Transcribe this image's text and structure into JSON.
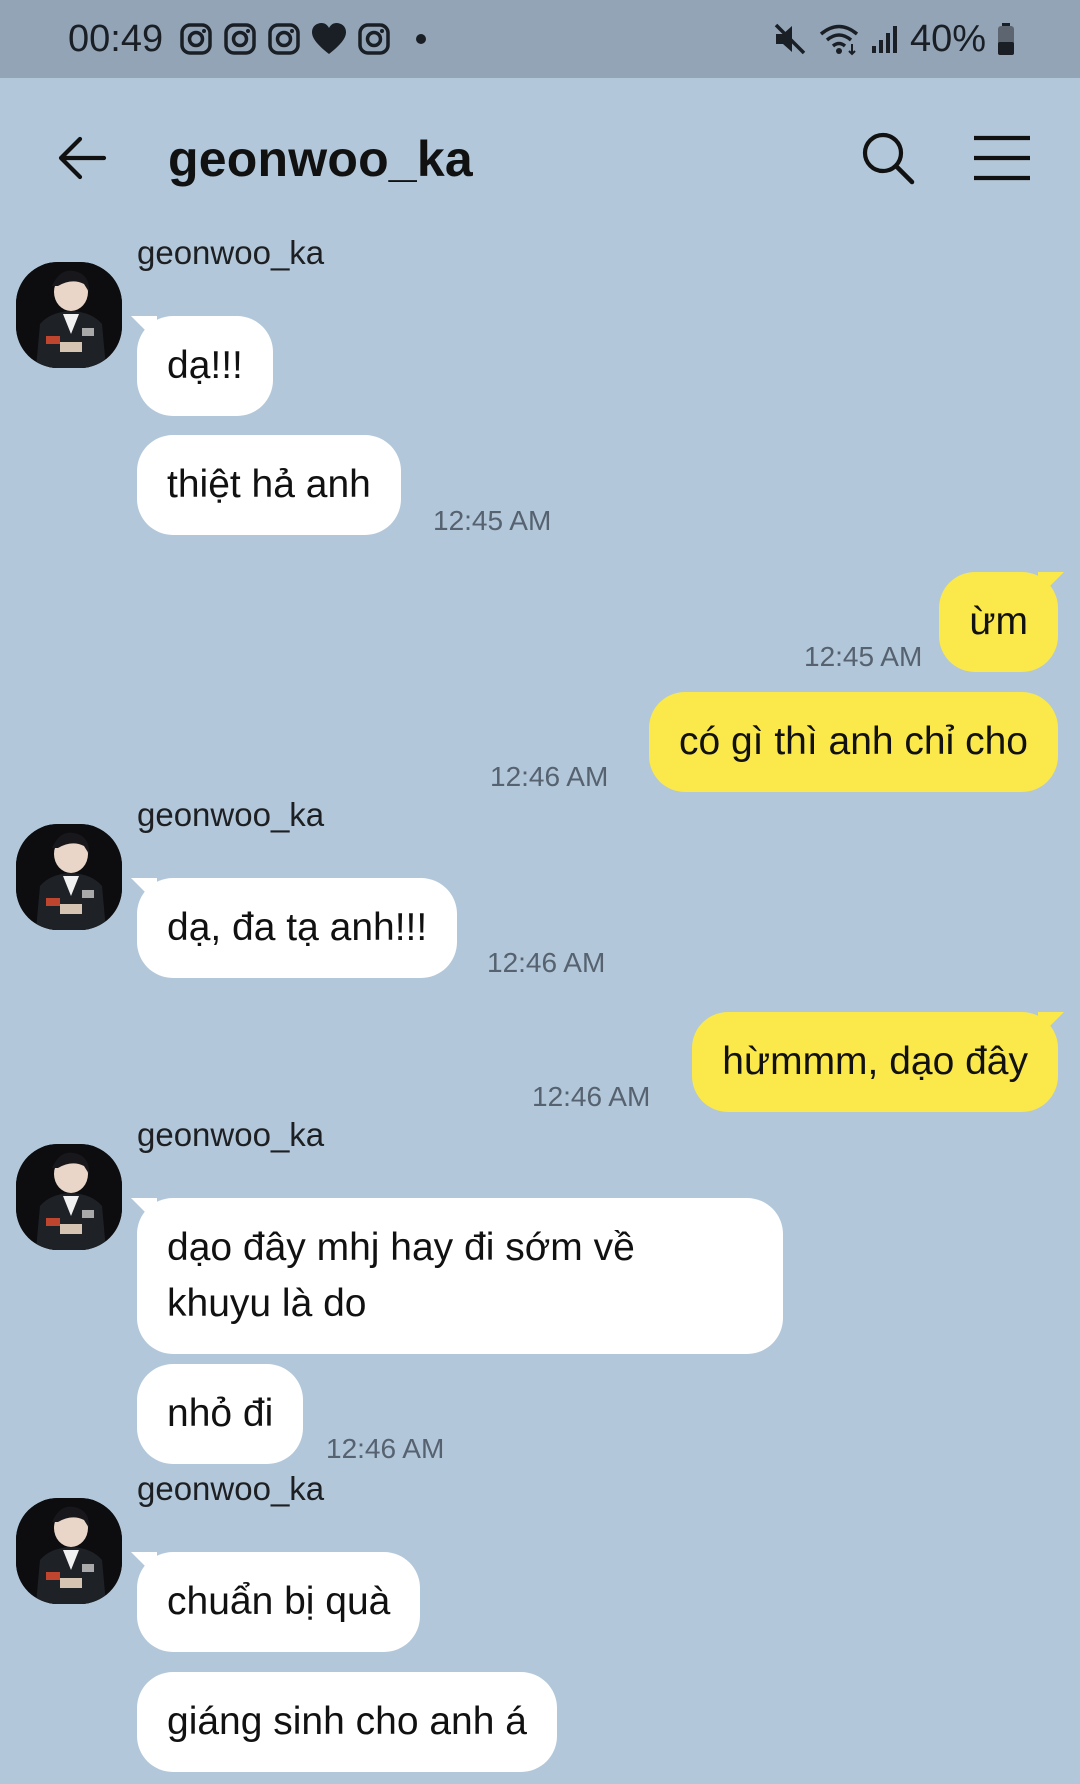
{
  "status_bar": {
    "time": "00:49",
    "battery": "40%",
    "notification_icons": [
      "instagram-icon",
      "instagram-icon",
      "instagram-icon",
      "heart-icon",
      "instagram-icon",
      "dot-icon"
    ],
    "system_icons": [
      "mute-icon",
      "wifi-icon",
      "signal-icon",
      "battery-icon"
    ]
  },
  "header": {
    "title": "geonwoo_ka",
    "icons": [
      "back-arrow-icon",
      "search-icon",
      "menu-icon"
    ]
  },
  "colors": {
    "background": "#b2c7d9",
    "status_bar": "#93a4b6",
    "incoming_bubble": "#ffffff",
    "outgoing_bubble": "#fbe84a",
    "timestamp": "#566270"
  },
  "messages": [
    {
      "direction": "in",
      "sender": "geonwoo_ka",
      "text": "dạ!!!"
    },
    {
      "direction": "in",
      "text": "thiệt hả anh",
      "time": "12:45 AM"
    },
    {
      "direction": "out",
      "text": "ừm",
      "time": "12:45 AM"
    },
    {
      "direction": "out",
      "text": "có gì thì anh chỉ cho",
      "time": "12:46 AM"
    },
    {
      "direction": "in",
      "sender": "geonwoo_ka",
      "text": "dạ, đa tạ anh!!!",
      "time": "12:46 AM"
    },
    {
      "direction": "out",
      "text": "hừmmm, dạo đây",
      "time": "12:46 AM"
    },
    {
      "direction": "in",
      "sender": "geonwoo_ka",
      "text": "dạo đây mhj hay đi sớm về\nkhuyu là do"
    },
    {
      "direction": "in",
      "text": "nhỏ đi",
      "time": "12:46 AM"
    },
    {
      "direction": "in",
      "sender": "geonwoo_ka",
      "text": "chuẩn bị quà"
    },
    {
      "direction": "in",
      "text": "giáng sinh cho anh á"
    }
  ]
}
